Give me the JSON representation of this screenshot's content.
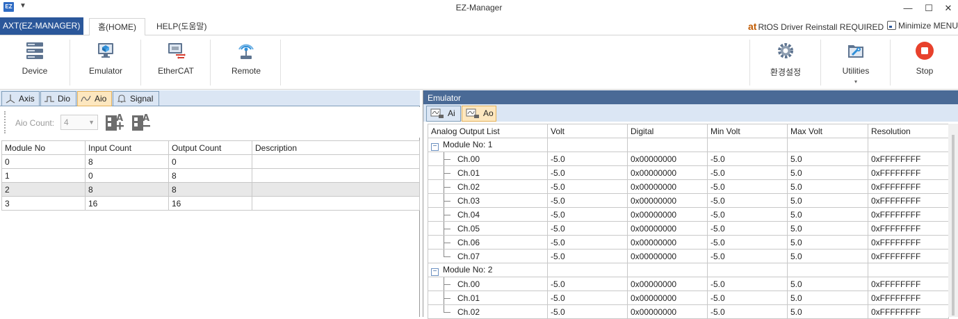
{
  "app": {
    "icon_text": "EZ",
    "title": "EZ-Manager"
  },
  "window": {
    "minimize": "—",
    "maximize": "☐",
    "close": "✕"
  },
  "ribbon_tabs": {
    "file": "AXT(EZ-MANAGER)",
    "home": "홈(HOME)",
    "help": "HELP(도움말)",
    "rtos_logo": "at",
    "rtos_status": "RtOS Driver Reinstall REQUIRED",
    "minimize_menu": "Minimize MENU"
  },
  "ribbon": {
    "device": "Device",
    "emulator": "Emulator",
    "ethercat": "EtherCAT",
    "remote": "Remote",
    "settings": "환경설정",
    "utilities": "Utilities",
    "stop": "Stop"
  },
  "left": {
    "tabs": [
      "Axis",
      "Dio",
      "Aio",
      "Signal"
    ],
    "active_tab": "Aio",
    "aio_count_label": "Aio Count:",
    "aio_count_value": "4",
    "columns": [
      "Module No",
      "Input Count",
      "Output Count",
      "Description"
    ],
    "rows": [
      [
        "0",
        "8",
        "0",
        ""
      ],
      [
        "1",
        "0",
        "8",
        ""
      ],
      [
        "2",
        "8",
        "8",
        ""
      ],
      [
        "3",
        "16",
        "16",
        ""
      ]
    ],
    "selected_row": 2
  },
  "right": {
    "title": "Emulator",
    "tabs": [
      "Ai",
      "Ao"
    ],
    "active_tab": "Ao",
    "columns": [
      "Analog Output List",
      "Volt",
      "Digital",
      "Min Volt",
      "Max Volt",
      "Resolution"
    ],
    "modules": [
      {
        "label": "Module No: 1",
        "channels": [
          [
            "Ch.00",
            "-5.0",
            "0x00000000",
            "-5.0",
            "5.0",
            "0xFFFFFFFF"
          ],
          [
            "Ch.01",
            "-5.0",
            "0x00000000",
            "-5.0",
            "5.0",
            "0xFFFFFFFF"
          ],
          [
            "Ch.02",
            "-5.0",
            "0x00000000",
            "-5.0",
            "5.0",
            "0xFFFFFFFF"
          ],
          [
            "Ch.03",
            "-5.0",
            "0x00000000",
            "-5.0",
            "5.0",
            "0xFFFFFFFF"
          ],
          [
            "Ch.04",
            "-5.0",
            "0x00000000",
            "-5.0",
            "5.0",
            "0xFFFFFFFF"
          ],
          [
            "Ch.05",
            "-5.0",
            "0x00000000",
            "-5.0",
            "5.0",
            "0xFFFFFFFF"
          ],
          [
            "Ch.06",
            "-5.0",
            "0x00000000",
            "-5.0",
            "5.0",
            "0xFFFFFFFF"
          ],
          [
            "Ch.07",
            "-5.0",
            "0x00000000",
            "-5.0",
            "5.0",
            "0xFFFFFFFF"
          ]
        ]
      },
      {
        "label": "Module No: 2",
        "channels": [
          [
            "Ch.00",
            "-5.0",
            "0x00000000",
            "-5.0",
            "5.0",
            "0xFFFFFFFF"
          ],
          [
            "Ch.01",
            "-5.0",
            "0x00000000",
            "-5.0",
            "5.0",
            "0xFFFFFFFF"
          ],
          [
            "Ch.02",
            "-5.0",
            "0x00000000",
            "-5.0",
            "5.0",
            "0xFFFFFFFF"
          ]
        ]
      }
    ]
  },
  "colors": {
    "ribbon_blue": "#2b579a",
    "active_tab": "#fde7bf",
    "panel_header": "#4a6a96",
    "stop_red": "#e8412c"
  }
}
